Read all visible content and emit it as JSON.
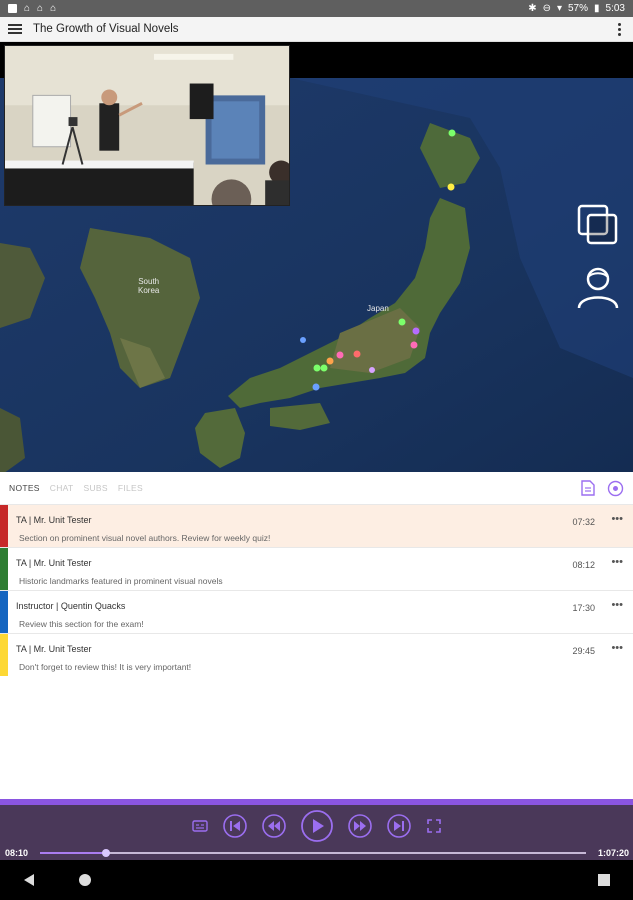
{
  "status_bar": {
    "battery": "57%",
    "time": "5:03",
    "icons": [
      "image-icon",
      "home-icon",
      "home-icon",
      "home-icon",
      "bluetooth-icon",
      "dnd-icon",
      "wifi-icon",
      "battery-icon"
    ]
  },
  "app_bar": {
    "title": "The Growth of Visual Novels"
  },
  "map": {
    "labels": {
      "south_korea": "South\nKorea",
      "japan": "Japan"
    }
  },
  "tabs": [
    {
      "label": "NOTES",
      "active": true
    },
    {
      "label": "CHAT",
      "active": false
    },
    {
      "label": "SUBS",
      "active": false
    },
    {
      "label": "FILES",
      "active": false
    }
  ],
  "notes": [
    {
      "author": "TA | Mr. Unit Tester",
      "text": "Section on prominent visual novel authors. Review for weekly quiz!",
      "time": "07:32",
      "color": "#c62828",
      "highlight": true
    },
    {
      "author": "TA | Mr. Unit Tester",
      "text": "Historic landmarks featured in prominent visual novels",
      "time": "08:12",
      "color": "#2e7d32",
      "highlight": false
    },
    {
      "author": "Instructor | Quentin Quacks",
      "text": "Review this section for the exam!",
      "time": "17:30",
      "color": "#1565c0",
      "highlight": false
    },
    {
      "author": "TA | Mr. Unit Tester",
      "text": "Don't forget to review this! It is very important!",
      "time": "29:45",
      "color": "#fdd835",
      "highlight": false
    }
  ],
  "more_label": "•••",
  "player": {
    "current_time": "08:10",
    "total_time": "1:07:20",
    "progress": 0.121,
    "accent": "#8a55e0"
  }
}
